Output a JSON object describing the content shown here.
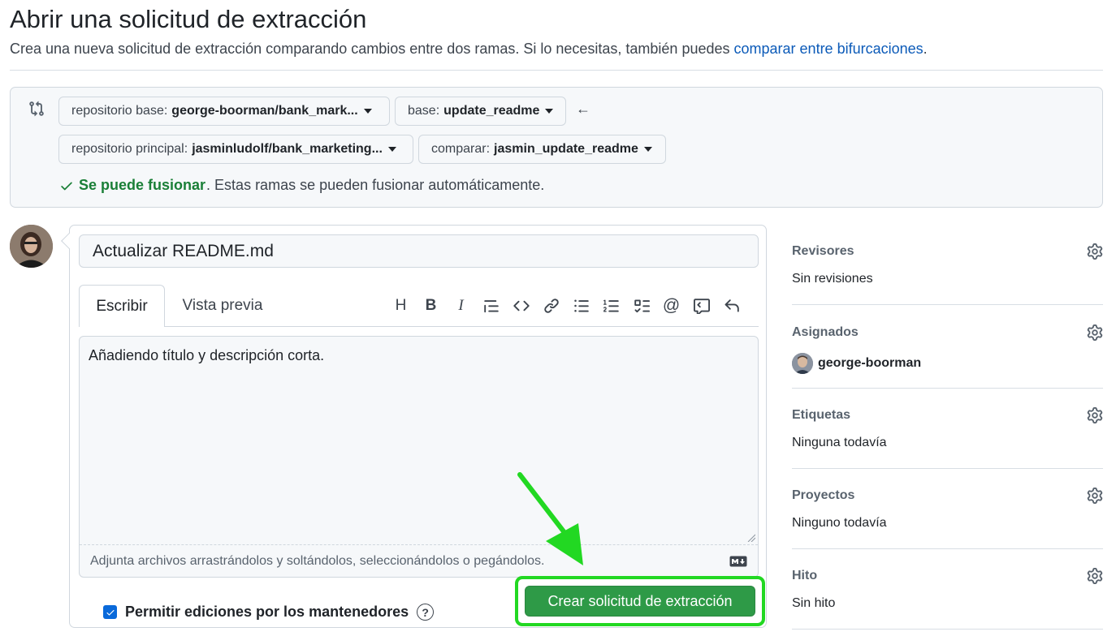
{
  "header": {
    "title": "Abrir una solicitud de extracción",
    "subtitle": "Crea una nueva solicitud de extracción comparando cambios entre dos ramas. Si lo necesitas, también puedes",
    "subtitle_link": "comparar entre bifurcaciones",
    "subtitle_end": "."
  },
  "compare": {
    "base_repo_label": "repositorio base:",
    "base_repo_value": "george-boorman/bank_mark...",
    "base_label": "base:",
    "base_value": "update_readme",
    "head_repo_label": "repositorio principal:",
    "head_repo_value": "jasminludolf/bank_marketing...",
    "compare_label": "comparar:",
    "compare_value": "jasmin_update_readme",
    "merge_status_bold": "Se puede fusionar",
    "merge_status_text": ". Estas ramas se pueden fusionar automáticamente."
  },
  "form": {
    "title_value": "Actualizar README.md",
    "tab_write": "Escribir",
    "tab_preview": "Vista previa",
    "body_text": "Añadiendo título y descripción corta.",
    "attach_hint": "Adjunta archivos arrastrándolos y soltándolos, seleccionándolos o pegándolos.",
    "allow_edits_label": "Permitir ediciones por los mantenedores",
    "allow_edits_checked": true,
    "create_button": "Crear solicitud de extracción",
    "toolbar_icons": [
      "heading-icon",
      "bold-icon",
      "italic-icon",
      "quote-icon",
      "code-icon",
      "link-icon",
      "unordered-list-icon",
      "ordered-list-icon",
      "task-list-icon",
      "mention-icon",
      "reference-icon",
      "undo-icon"
    ]
  },
  "sidebar": {
    "reviewers": {
      "heading": "Revisores",
      "value": "Sin revisiones"
    },
    "assignees": {
      "heading": "Asignados",
      "value": "george-boorman"
    },
    "labels": {
      "heading": "Etiquetas",
      "value": "Ninguna todavía"
    },
    "projects": {
      "heading": "Proyectos",
      "value": "Ninguno todavía"
    },
    "milestone": {
      "heading": "Hito",
      "value": "Sin hito"
    }
  },
  "colors": {
    "accent_green": "#2e9a47",
    "highlight_green": "#22d822",
    "link_blue": "#0b5ab8",
    "success_text": "#1a7f37"
  }
}
